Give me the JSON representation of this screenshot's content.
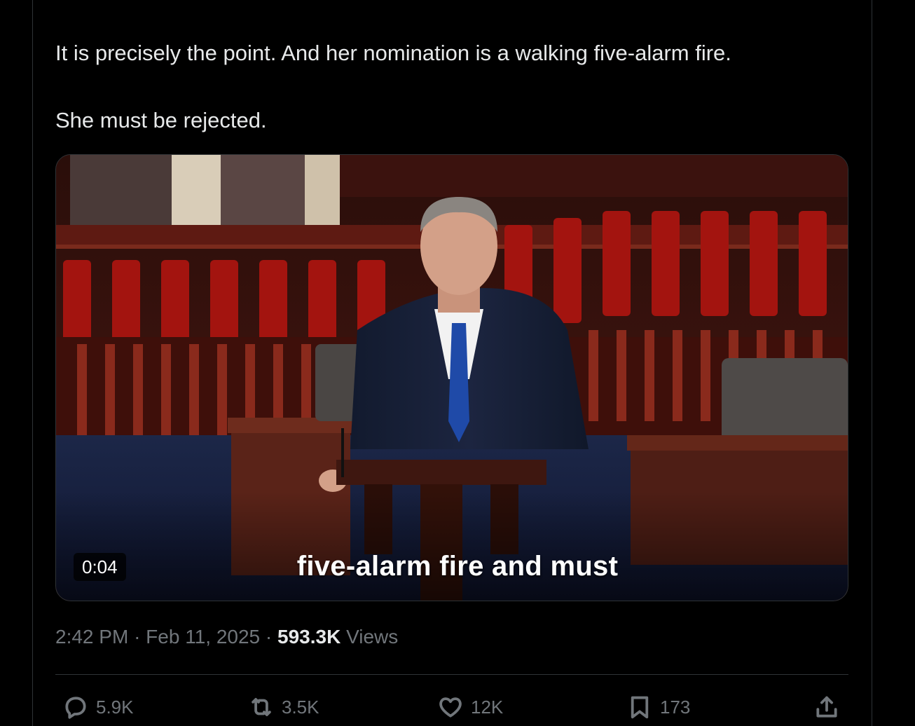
{
  "tweet": {
    "paragraphs": [
      "It is precisely the point. And her nomination is a walking five-alarm fire.",
      "She must be rejected."
    ]
  },
  "video": {
    "duration": "0:04",
    "caption": "five-alarm fire and must"
  },
  "meta": {
    "time": "2:42 PM",
    "date": "Feb 11, 2025",
    "views_count": "593.3K",
    "views_label": "Views",
    "separator": "·"
  },
  "actions": {
    "replies": "5.9K",
    "reposts": "3.5K",
    "likes": "12K",
    "bookmarks": "173"
  },
  "colors": {
    "background": "#000000",
    "text": "#e7e9ea",
    "secondary": "#71767b",
    "border": "#2f3336"
  }
}
